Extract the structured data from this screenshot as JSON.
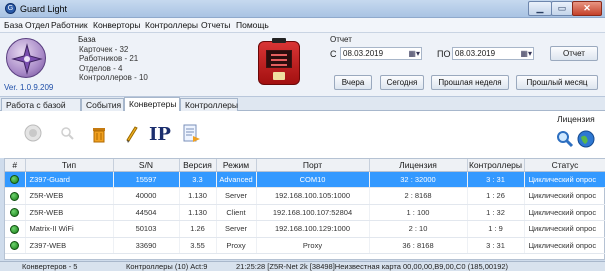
{
  "window": {
    "title": "Guard Light",
    "min": "▁",
    "max": "▭",
    "close": "✕"
  },
  "menu": [
    "База",
    "Отдел",
    "Работник",
    "Конверторы",
    "Контроллеры",
    "Отчеты",
    "Помощь"
  ],
  "info": {
    "heading": "База",
    "cards": "Карточек - 32",
    "workers": "Работников - 21",
    "departments": "Отделов - 4",
    "controllers": "Контроллеров - 10",
    "version": "Ver. 1.0.9.209"
  },
  "report": {
    "label": "Отчет",
    "from_label": "С",
    "from_date": "08.03.2019",
    "to_label": "ПО",
    "to_date": "08.03.2019",
    "report_button": "Отчет",
    "yesterday": "Вчера",
    "today": "Сегодня",
    "last_week": "Прошлая неделя",
    "last_month": "Прошлый месяц"
  },
  "tabs": [
    "Работа с базой",
    "События",
    "Конвертеры",
    "Контроллеры"
  ],
  "active_tab": 2,
  "toolbar": {
    "license_label": "Лицензия"
  },
  "table": {
    "columns": [
      "#",
      "Тип",
      "S/N",
      "Версия",
      "Режим",
      "Порт",
      "Лицензия",
      "Контроллеры",
      "Статус"
    ],
    "rows": [
      {
        "type": "Z397-Guard",
        "sn": "15597",
        "version": "3.3",
        "mode": "Advanced",
        "port": "COM10",
        "license": "32 : 32000",
        "controllers": "3 : 31",
        "status": "Циклический опрос",
        "selected": true
      },
      {
        "type": "Z5R-WEB",
        "sn": "40000",
        "version": "1.130",
        "mode": "Server",
        "port": "192.168.100.105:1000",
        "license": "2 : 8168",
        "controllers": "1 : 26",
        "status": "Циклический опрос",
        "selected": false
      },
      {
        "type": "Z5R-WEB",
        "sn": "44504",
        "version": "1.130",
        "mode": "Client",
        "port": "192.168.100.107:52804",
        "license": "1 : 100",
        "controllers": "1 : 32",
        "status": "Циклический опрос",
        "selected": false
      },
      {
        "type": "Matrix-II WiFi",
        "sn": "50103",
        "version": "1.26",
        "mode": "Server",
        "port": "192.168.100.129:1000",
        "license": "2 : 10",
        "controllers": "1 : 9",
        "status": "Циклический опрос",
        "selected": false
      },
      {
        "type": "Z397-WEB",
        "sn": "33690",
        "version": "3.55",
        "mode": "Proxy",
        "port": "Proxy",
        "license": "36 : 8168",
        "controllers": "3 : 31",
        "status": "Циклический опрос",
        "selected": false
      }
    ]
  },
  "status": {
    "converters": "Конвертеров - 5",
    "controllers": "Контроллеры (10) Act:9",
    "event": "21:25:28 [Z5R-Net 2k [38498]Неизвестная карта 00,00,00,B9,00,C0 (185,00192)"
  },
  "colors": {
    "selected_row": "#3399ff",
    "version_link": "#1f4fa8"
  }
}
